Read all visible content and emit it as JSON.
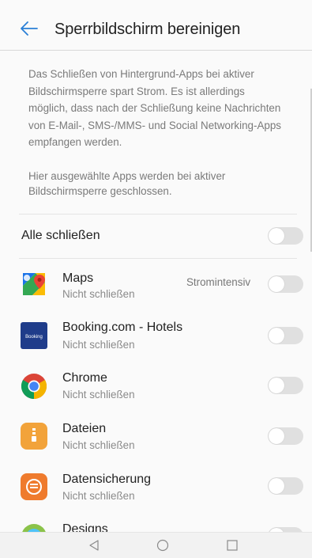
{
  "header": {
    "title": "Sperrbildschirm bereinigen"
  },
  "description": {
    "paragraph1": [
      "Das Schließen von Hintergrund-Apps bei aktiver",
      "Bildschirmsperre spart Strom. Es ist allerdings",
      "möglich, dass nach der Schließung keine Nachrichten",
      "von E-Mail-, SMS-/MMS- und Social Networking-Apps",
      "empfangen werden."
    ],
    "paragraph2": [
      "Hier ausgewählte Apps werden bei aktiver",
      "Bildschirmsperre geschlossen."
    ]
  },
  "close_all": {
    "label": "Alle schließen",
    "enabled": false
  },
  "apps": [
    {
      "name": "Maps",
      "status": "Nicht schließen",
      "badge": "Stromintensiv",
      "icon": "google-maps-icon",
      "enabled": false
    },
    {
      "name": "Booking.com - Hotels",
      "status": "Nicht schließen",
      "icon": "booking-icon",
      "icon_text": "Booking",
      "enabled": false
    },
    {
      "name": "Chrome",
      "status": "Nicht schließen",
      "icon": "chrome-icon",
      "enabled": false
    },
    {
      "name": "Dateien",
      "status": "Nicht schließen",
      "icon": "files-icon",
      "enabled": false
    },
    {
      "name": "Datensicherung",
      "status": "Nicht schließen",
      "icon": "backup-icon",
      "enabled": false
    },
    {
      "name": "Designs",
      "icon": "themes-icon",
      "enabled": false
    }
  ],
  "colors": {
    "accent": "#2a7fd6",
    "toggle_off": "#e0e0e0",
    "background": "#fafafa"
  },
  "navbar": {
    "back": "nav-back-icon",
    "home": "nav-home-icon",
    "recents": "nav-recents-icon"
  }
}
